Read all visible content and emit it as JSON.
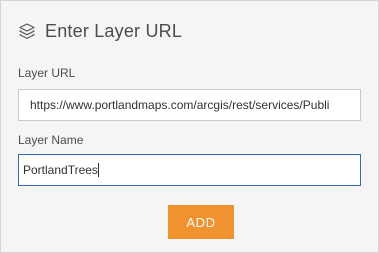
{
  "header": {
    "title": "Enter Layer URL",
    "icon": "layers-icon"
  },
  "form": {
    "url_label": "Layer URL",
    "url_value": "https://www.portlandmaps.com/arcgis/rest/services/Publi",
    "name_label": "Layer Name",
    "name_value": "PortlandTrees",
    "add_label": "ADD"
  },
  "colors": {
    "panel_bg": "#f5f5f5",
    "accent_button": "#f0932e",
    "focus_border": "#2f6db5",
    "text": "#4c4c4c"
  }
}
